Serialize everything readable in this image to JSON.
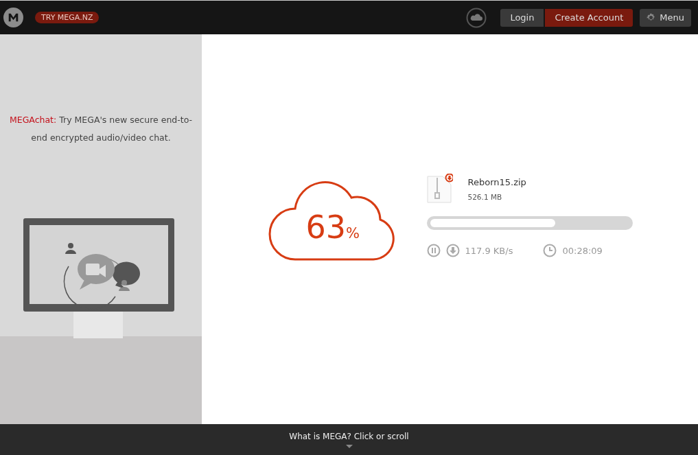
{
  "header": {
    "badge": "TRY MEGA.NZ",
    "buttons": [
      {
        "label": "Login",
        "kind": "dark"
      },
      {
        "label": "Create Account",
        "kind": "red"
      },
      {
        "label": "Menu",
        "kind": "menu"
      }
    ]
  },
  "promo": {
    "label": "MEGAchat:",
    "text": " Try MEGA's new secure end-to-end encrypted audio/video chat."
  },
  "download": {
    "percent": "63",
    "percent_sign": "%",
    "file_name": "Reborn15.zip",
    "file_size": "526.1 MB",
    "level": 0.63,
    "paused": false,
    "speed": "117.9 KB/s",
    "time_left": "00:28:09"
  },
  "footer": {
    "text": "What is MEGA? Click or scroll"
  }
}
